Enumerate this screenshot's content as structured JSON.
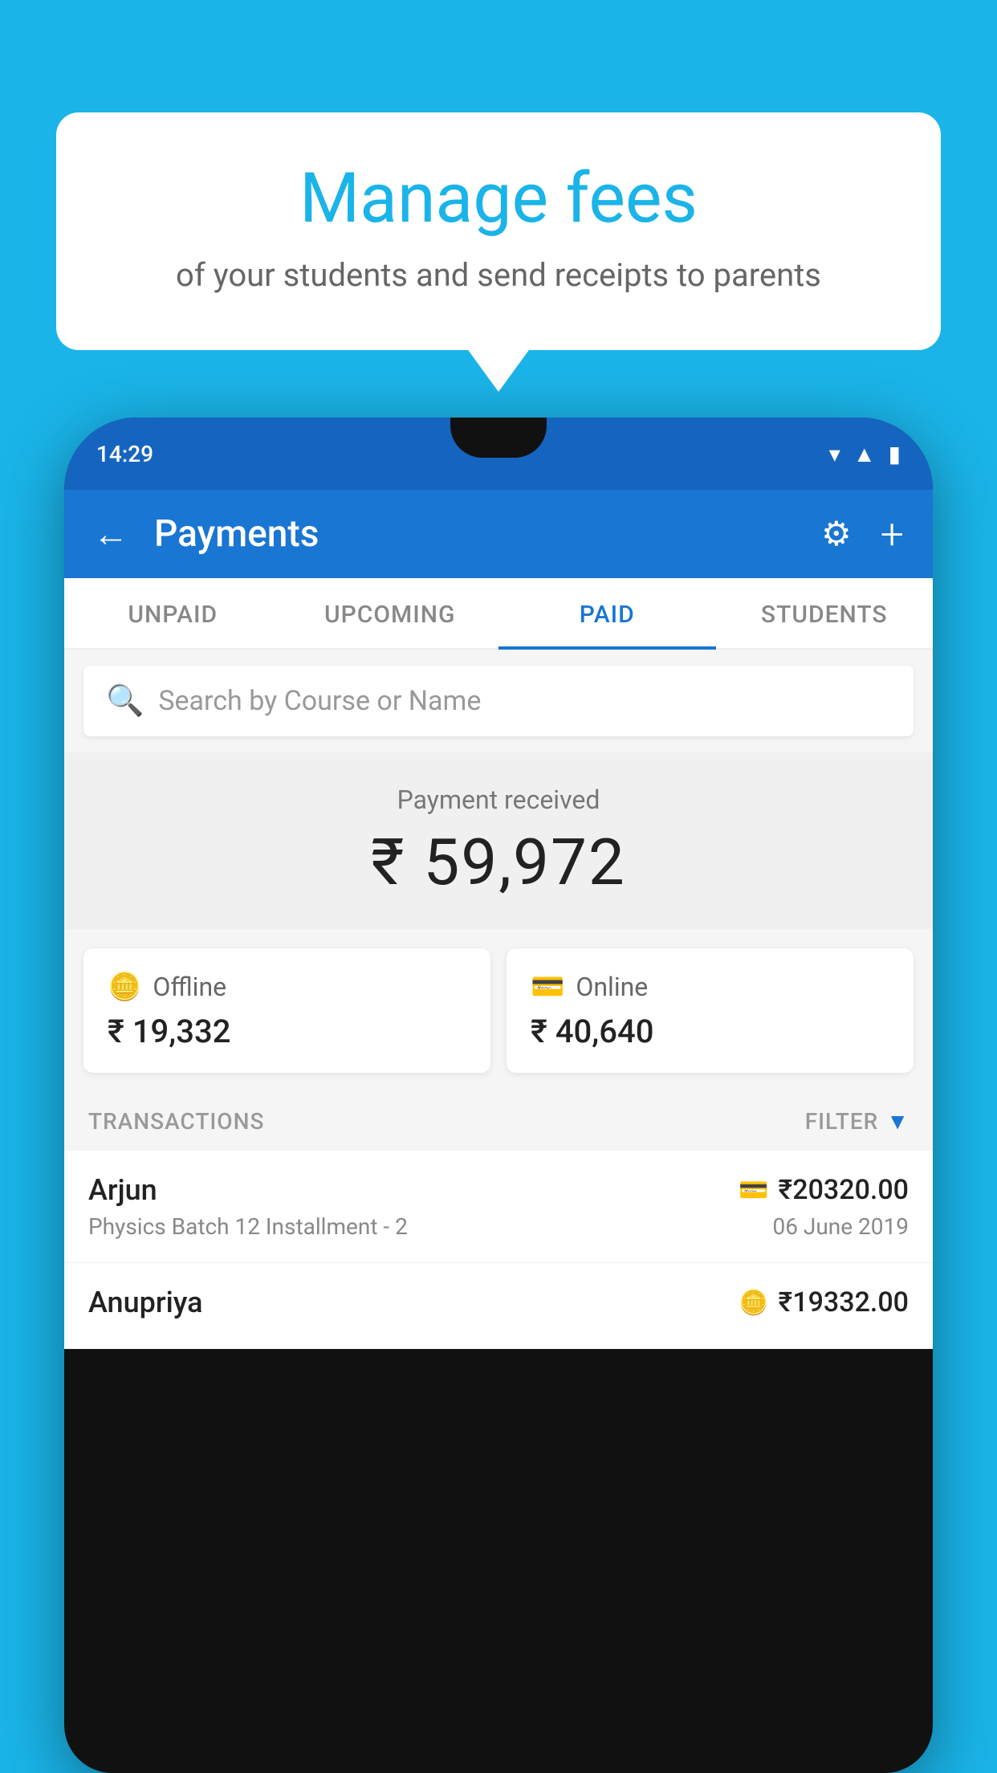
{
  "background_color": "#1ab4e8",
  "speech_bubble": {
    "title": "Manage fees",
    "subtitle": "of your students and send receipts to parents"
  },
  "phone": {
    "status_bar": {
      "time": "14:29"
    },
    "header": {
      "title": "Payments",
      "back_label": "←",
      "gear_label": "⚙",
      "plus_label": "+"
    },
    "tabs": [
      {
        "label": "UNPAID",
        "active": false
      },
      {
        "label": "UPCOMING",
        "active": false
      },
      {
        "label": "PAID",
        "active": true
      },
      {
        "label": "STUDENTS",
        "active": false
      }
    ],
    "search": {
      "placeholder": "Search by Course or Name"
    },
    "payment_summary": {
      "label": "Payment received",
      "amount": "₹ 59,972"
    },
    "payment_cards": [
      {
        "label": "Offline",
        "amount": "₹ 19,332",
        "icon": "💳"
      },
      {
        "label": "Online",
        "amount": "₹ 40,640",
        "icon": "💳"
      }
    ],
    "transactions_header": {
      "label": "TRANSACTIONS",
      "filter_label": "FILTER"
    },
    "transactions": [
      {
        "name": "Arjun",
        "course": "Physics Batch 12 Installment - 2",
        "amount": "₹20320.00",
        "date": "06 June 2019"
      },
      {
        "name": "Anupriya",
        "course": "",
        "amount": "₹19332.00",
        "date": ""
      }
    ]
  }
}
